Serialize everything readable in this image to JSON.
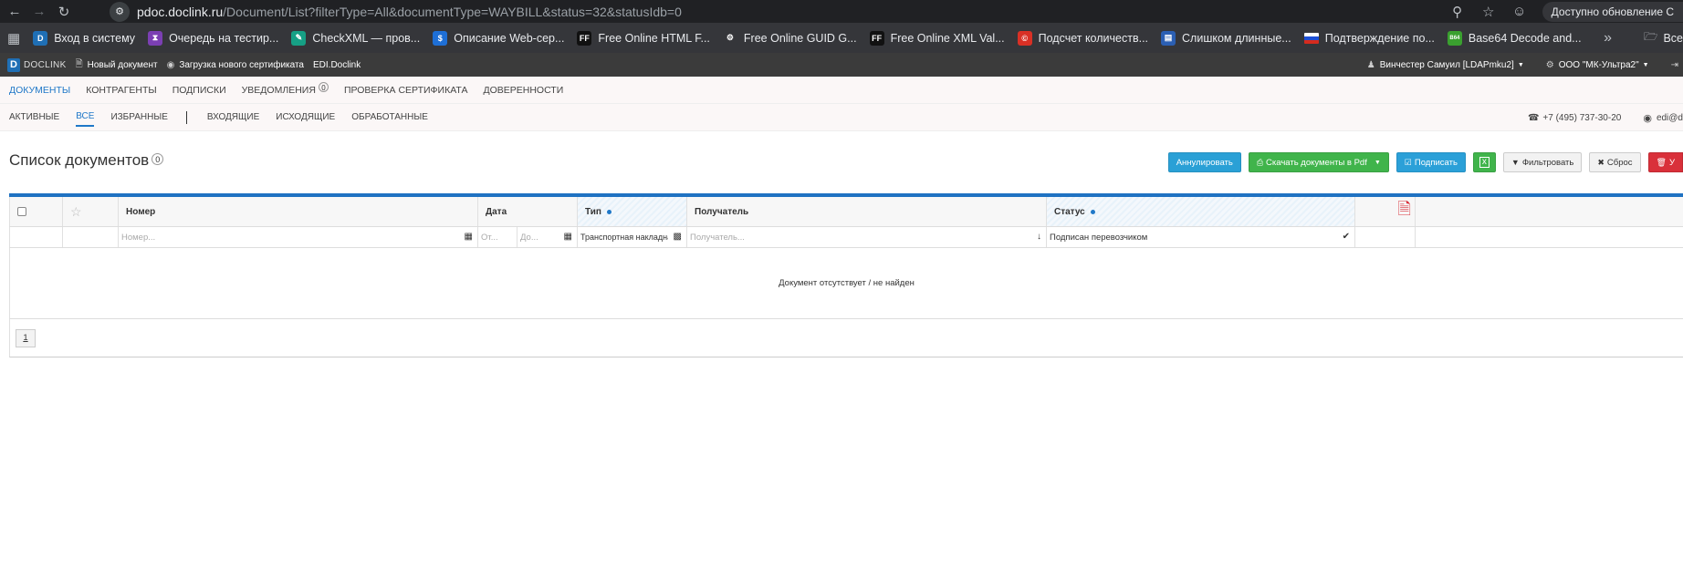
{
  "browser": {
    "url_host": "pdoc.doclink.ru",
    "url_path": "/Document/List?filterType=All&documentType=WAYBILL&status=32&statusIdb=0",
    "update_label": "Доступно обновление С",
    "bookmarks": [
      {
        "label": "Вход в систему",
        "icon": "doclink-icon",
        "color": "#1f6fb5",
        "glyph": "D"
      },
      {
        "label": "Очередь на тестир...",
        "icon": "visual-studio-icon",
        "color": "#7b3fb3",
        "glyph": "⧗"
      },
      {
        "label": "CheckXML — пров...",
        "icon": "checkxml-icon",
        "color": "#16a085",
        "glyph": "✎"
      },
      {
        "label": "Описание Web-сер...",
        "icon": "dollar-icon",
        "color": "#1e6fd6",
        "glyph": "$"
      },
      {
        "label": "Free Online HTML F...",
        "icon": "ff-icon",
        "color": "#111111",
        "glyph": "FF"
      },
      {
        "label": "Free Online GUID G...",
        "icon": "gear-cluster-icon",
        "color": "#35363a",
        "glyph": "⚙"
      },
      {
        "label": "Free Online XML Val...",
        "icon": "ff-icon",
        "color": "#111111",
        "glyph": "FF"
      },
      {
        "label": "Подсчет количеств...",
        "icon": "copyright-icon",
        "color": "#d93025",
        "glyph": "©"
      },
      {
        "label": "Слишком длинные...",
        "icon": "book-icon",
        "color": "#2b5fb3",
        "glyph": "▤"
      },
      {
        "label": "Подтверждение по...",
        "icon": "russia-flag-icon",
        "color": "#ffffff",
        "glyph": ""
      },
      {
        "label": "Base64 Decode and...",
        "icon": "b64-icon",
        "color": "#3aa02f",
        "glyph": "B64"
      }
    ],
    "all_bookmarks_label": "Все"
  },
  "app": {
    "logo_text": "DOCLINK",
    "header_items": [
      {
        "label": "Новый документ",
        "icon": "document-icon"
      },
      {
        "label": "Загрузка нового сертификата",
        "icon": "certificate-icon"
      },
      {
        "label": "EDI.Doclink",
        "icon": ""
      }
    ],
    "user_label": "Винчестер Самуил [LDAPmku2]",
    "org_label": "ООО \"МК-Ультра2\""
  },
  "main_nav": [
    {
      "label": "ДОКУМЕНТЫ",
      "active": true
    },
    {
      "label": "КОНТРАГЕНТЫ",
      "active": false
    },
    {
      "label": "ПОДПИСКИ",
      "active": false
    },
    {
      "label": "УВЕДОМЛЕНИЯ",
      "active": false,
      "badge": "0"
    },
    {
      "label": "ПРОВЕРКА СЕРТИФИКАТА",
      "active": false
    },
    {
      "label": "ДОВЕРЕННОСТИ",
      "active": false
    }
  ],
  "sub_nav": {
    "left": [
      {
        "label": "АКТИВНЫЕ",
        "active": false
      },
      {
        "label": "ВСЕ",
        "active": true
      },
      {
        "label": "ИЗБРАННЫЕ",
        "active": false
      }
    ],
    "right": [
      {
        "label": "ВХОДЯЩИЕ",
        "active": false
      },
      {
        "label": "ИСХОДЯЩИЕ",
        "active": false
      },
      {
        "label": "ОБРАБОТАННЫЕ",
        "active": false
      }
    ],
    "phone": "+7 (495) 737-30-20",
    "email": "edi@d"
  },
  "page": {
    "title": "Список документов",
    "count": "0",
    "buttons": {
      "annul": "Аннулировать",
      "download_pdf": "Скачать документы в Pdf",
      "sign": "Подписать",
      "filter": "Фильтровать",
      "reset": "Сброс",
      "delete": "У"
    }
  },
  "grid": {
    "columns": {
      "number": "Номер",
      "date": "Дата",
      "type": "Тип",
      "recipient": "Получатель",
      "status": "Статус"
    },
    "filters": {
      "number_placeholder": "Номер...",
      "date_from_placeholder": "От...",
      "date_to_placeholder": "До...",
      "type_value": "Транспортная накладная",
      "recipient_placeholder": "Получатель...",
      "status_value": "Подписан перевозчиком"
    },
    "empty_message": "Документ отсутствует / не найден",
    "pages": [
      "1"
    ]
  }
}
